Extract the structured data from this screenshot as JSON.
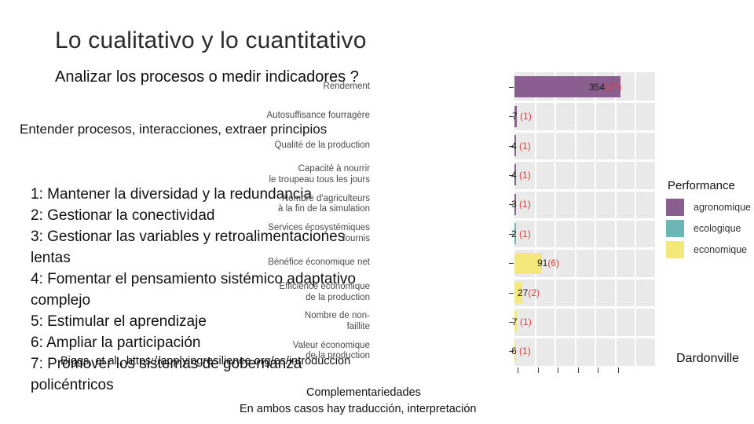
{
  "slide": {
    "title": "Lo cualitativo y lo cuantitativo",
    "subtitle": "Analizar los procesos o medir indicadores ?",
    "lead": "Entender procesos, interacciones, extraer principios",
    "principles": [
      "1: Mantener la diversidad y la redundancia",
      "2: Gestionar la conectividad",
      "3: Gestionar las variables y retroalimentaciones lentas",
      "4: Fomentar el pensamiento sistémico adaptativo complejo",
      "5: Estimular el aprendizaje",
      "6: Ampliar la participación",
      "7: Promover los sistemas de gobernanza policéntricos"
    ],
    "source": "Biggs, et al., https://applyingresilience.org/es/introduccion",
    "complement": "Complementariedades",
    "both_cases": "En ambos casos hay traducción, interpretación",
    "author": "Dardonville"
  },
  "legend": {
    "title": "Performance",
    "items": [
      {
        "label": "agronomique",
        "color": "#8a5f8f"
      },
      {
        "label": "ecologique",
        "color": "#6cb6b6"
      },
      {
        "label": "economique",
        "color": "#f5e87a"
      }
    ]
  },
  "chart_data": {
    "type": "bar",
    "orientation": "horizontal",
    "title": "",
    "xlabel": "",
    "ylabel": "",
    "xlim": [
      0,
      470
    ],
    "grid": true,
    "legend_position": "right",
    "categories": [
      "Rendement",
      "Autosuffisance fourragère",
      "Qualité de la production",
      "Capacité à nourrir\nle troupeau tous les jours",
      "Nombre d'agriculteurs\nà la fin de la simulation",
      "Services écosystémiques\nfournis",
      "Bénéfice économique net",
      "Efficience economique\nde la production",
      "Nombre de non-\nfaillite",
      "Valeur économique\nde la production"
    ],
    "values": [
      354,
      7,
      4,
      4,
      3,
      2,
      91,
      27,
      7,
      6
    ],
    "secondary_values": [
      27,
      1,
      1,
      1,
      1,
      1,
      6,
      2,
      1,
      1
    ],
    "value_labels": [
      "354",
      "7",
      "4",
      "4",
      "3",
      "2",
      "91",
      "27",
      "7",
      "6"
    ],
    "paren_labels": [
      "(27)",
      "(1)",
      "(1)",
      "(1)",
      "(1)",
      "(1)",
      "(6)",
      "(2)",
      "(1)",
      "(1)"
    ],
    "group": [
      "agronomique",
      "agronomique",
      "agronomique",
      "agronomique",
      "agronomique",
      "ecologique",
      "economique",
      "economique",
      "economique",
      "economique"
    ],
    "colors": {
      "agronomique": "#8a5f8f",
      "ecologique": "#6cb6b6",
      "economique": "#f5e87a"
    }
  }
}
